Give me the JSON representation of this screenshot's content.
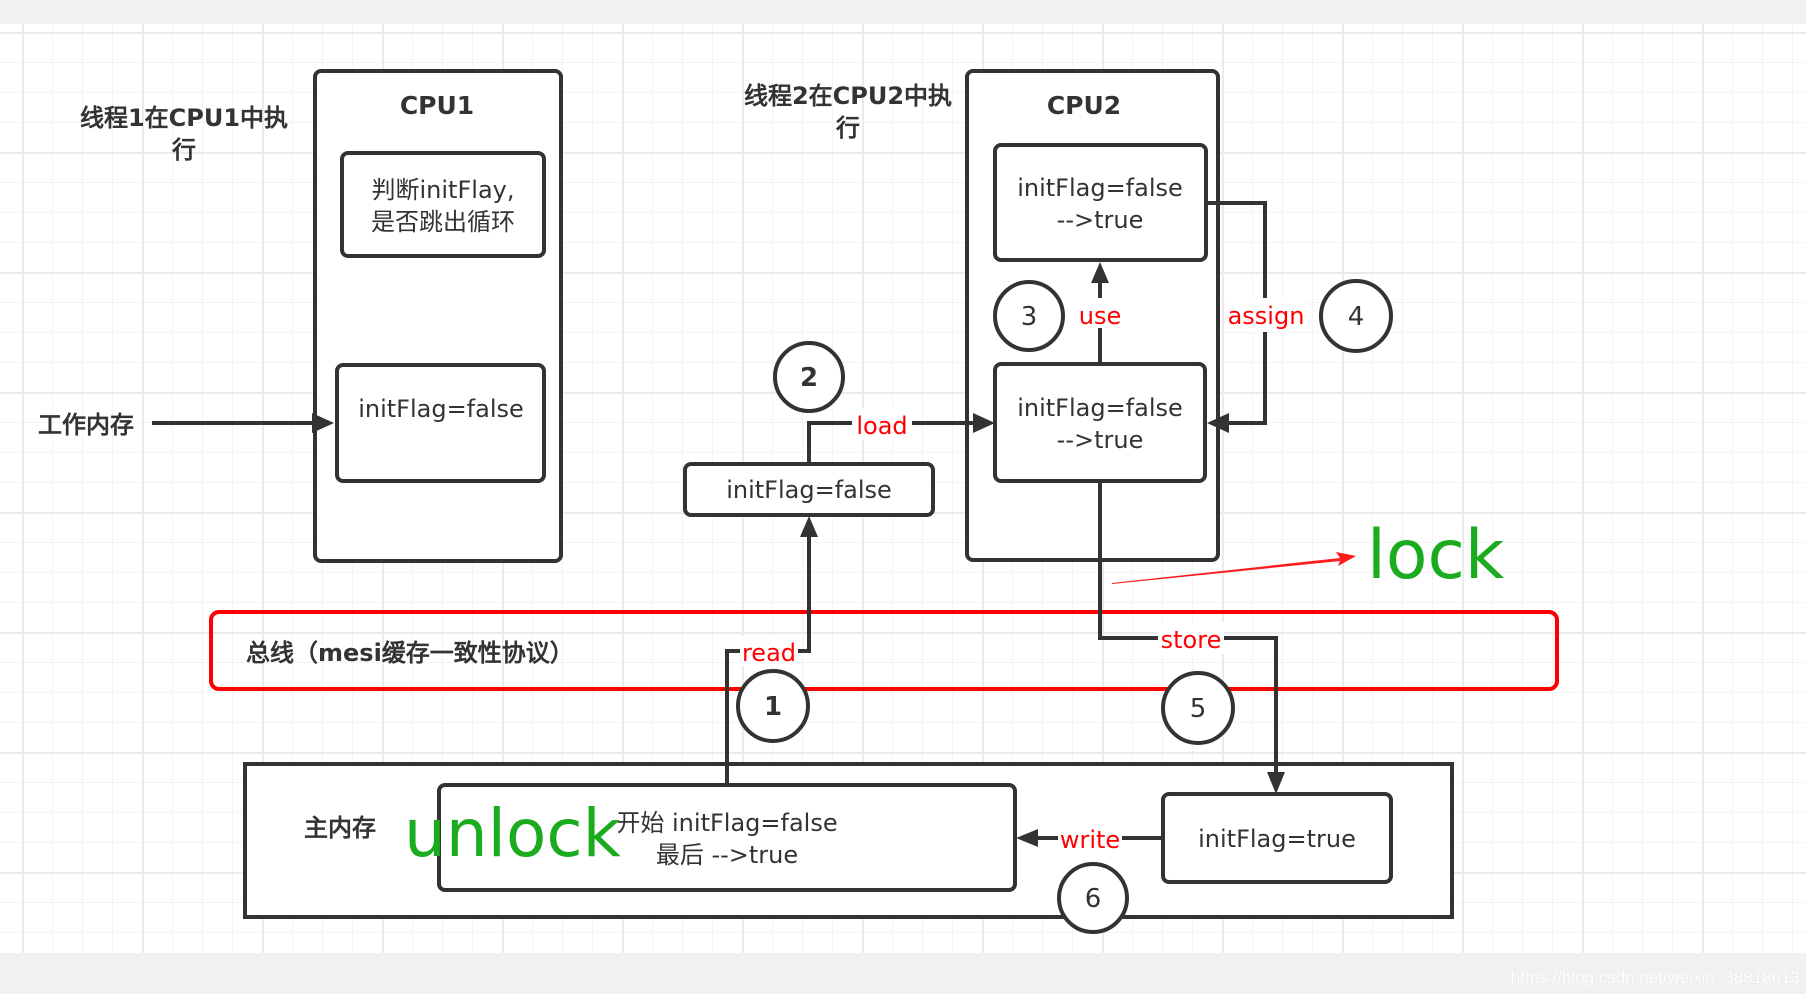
{
  "cpu1": {
    "title": "CPU1",
    "thread_label_line1": "线程1在CPU1中执",
    "thread_label_line2": "行",
    "instruction_line1": "判断initFlay,",
    "instruction_line2": "是否跳出循环",
    "working_copy": "initFlag=false"
  },
  "working_memory_label": "工作内存",
  "cpu2": {
    "title": "CPU2",
    "thread_label_line1": "线程2在CPU2中执",
    "thread_label_line2": "行",
    "engine_line1": "initFlag=false",
    "engine_line2": "-->true",
    "working_line1": "initFlag=false",
    "working_line2": "-->true"
  },
  "bus_buffer": "initFlag=false",
  "bus": {
    "label": "总线（mesi缓存一致性协议）",
    "border_color": "#ff0000"
  },
  "main_memory": {
    "label": "主内存",
    "variable_line1": "开始 initFlag=false",
    "variable_line2": "最后 -->true",
    "store_buffer": "initFlag=true"
  },
  "operations": [
    {
      "step": "1",
      "name": "read"
    },
    {
      "step": "2",
      "name": "load"
    },
    {
      "step": "3",
      "name": "use"
    },
    {
      "step": "4",
      "name": "assign"
    },
    {
      "step": "5",
      "name": "store"
    },
    {
      "step": "6",
      "name": "write"
    }
  ],
  "annotations": {
    "lock": "lock",
    "unlock": "unlock",
    "color": "#1aab1f"
  },
  "watermark": "https://blog.csdn.net/weixin_38818613"
}
